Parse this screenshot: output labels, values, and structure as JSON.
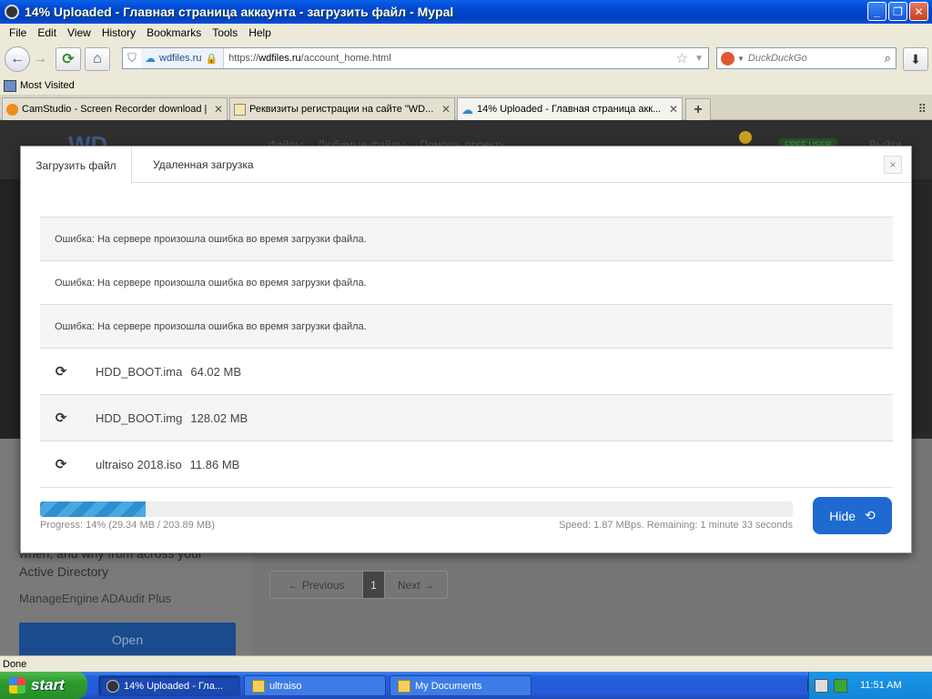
{
  "window": {
    "title": "14% Uploaded - Главная страница аккаунта - загрузить файл - Mypal",
    "min_label": "_",
    "max_label": "❐",
    "close_label": "✕"
  },
  "menu": [
    "File",
    "Edit",
    "View",
    "History",
    "Bookmarks",
    "Tools",
    "Help"
  ],
  "nav": {
    "site_badge": "wdfiles.ru",
    "url_prefix": "https://",
    "url_domain": "wdfiles.ru",
    "url_path": "/account_home.html",
    "search_placeholder": "DuckDuckGo"
  },
  "bookmarks": {
    "most_visited": "Most Visited"
  },
  "tabs": [
    {
      "label": "CamStudio - Screen Recorder download |...",
      "icon": "camstudio-icon"
    },
    {
      "label": "Реквизиты регистрации на сайте \"WD...",
      "icon": "mail-icon"
    },
    {
      "label": "14% Uploaded - Главная страница акк...",
      "icon": "cloud-icon"
    }
  ],
  "page": {
    "logo": "WD",
    "nav_files": "Файлы",
    "nav_fav": "Любимые файлы",
    "nav_shared": "Помощь проекту",
    "free_user": "FREE USER",
    "logout": "Выйти",
    "ad_line1": "when, and why from across your",
    "ad_line2": "Active Directory",
    "ad_brand": "ManageEngine ADAudit Plus",
    "ad_open": "Open",
    "pager_prev": "← Previous",
    "pager_num": "1",
    "pager_next": "Next →"
  },
  "modal": {
    "tab_upload": "Загрузить файл",
    "tab_remote": "Удаленная загрузка",
    "close": "×",
    "errors": [
      "Ошибка: На сервере произошла ошибка во время загрузки файла.",
      "Ошибка: На сервере произошла ошибка во время загрузки файла.",
      "Ошибка: На сервере произошла ошибка во время загрузки файла."
    ],
    "files": [
      {
        "name": "HDD_BOOT.ima",
        "size": "64.02 MB"
      },
      {
        "name": "HDD_BOOT.img",
        "size": "128.02 MB"
      },
      {
        "name": "ultraiso 2018.iso",
        "size": "11.86 MB"
      }
    ],
    "progress_value": 14,
    "progress_text": "Progress: 14% (29.34 MB / 203.89 MB)",
    "speed_text": "Speed: 1.87 MBps. Remaining: 1 minute 33 seconds",
    "hide_label": "Hide"
  },
  "status": "Done",
  "taskbar": {
    "start": "start",
    "items": [
      {
        "label": "14% Uploaded - Гла...",
        "icon": "mypal-icon"
      },
      {
        "label": "ultraiso",
        "icon": "folder-icon"
      },
      {
        "label": "My Documents",
        "icon": "folder-icon"
      }
    ],
    "clock": "11:51 AM"
  }
}
